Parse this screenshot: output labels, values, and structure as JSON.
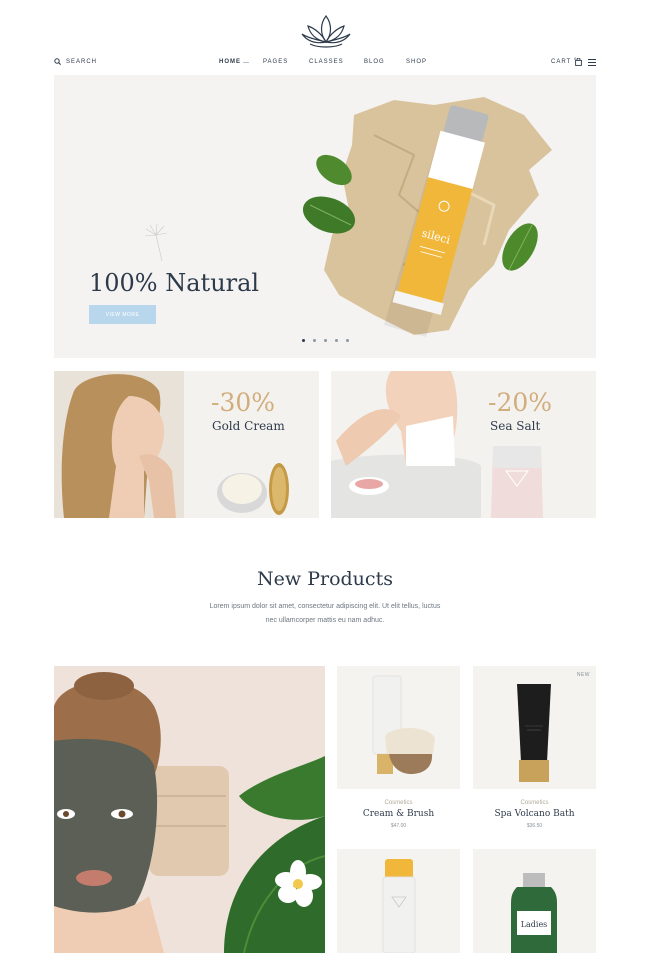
{
  "header": {
    "search_label": "SEARCH",
    "nav": [
      "HOME",
      "PAGES",
      "CLASSES",
      "BLOG",
      "SHOP"
    ],
    "cart_label": "CART",
    "cart_count": "0"
  },
  "hero": {
    "title": "100% Natural",
    "button_label": "VIEW MORE",
    "tube_brand": "sileci",
    "slides": 5,
    "active_slide": 0
  },
  "promos": [
    {
      "discount": "-30%",
      "name": "Gold Cream"
    },
    {
      "discount": "-20%",
      "name": "Sea Salt"
    }
  ],
  "new_products": {
    "title": "New Products",
    "text_line1": "Lorem ipsum dolor sit amet, consectetur adipiscing elit. Ut elit tellus, luctus",
    "text_line2": "nec ullamcorper mattis eu nam adhuc."
  },
  "products": [
    {
      "category": "Cosmetics",
      "name": "Cream & Brush",
      "price": "$47.00",
      "badge": ""
    },
    {
      "category": "Cosmetics",
      "name": "Spa Volcano Bath",
      "price": "$36.50",
      "badge": "NEW"
    }
  ],
  "bottle_label": "Ladies",
  "colors": {
    "accent_gold": "#d2ad7c",
    "button_blue": "#b9d7ec",
    "text_navy": "#2d3a4a"
  }
}
